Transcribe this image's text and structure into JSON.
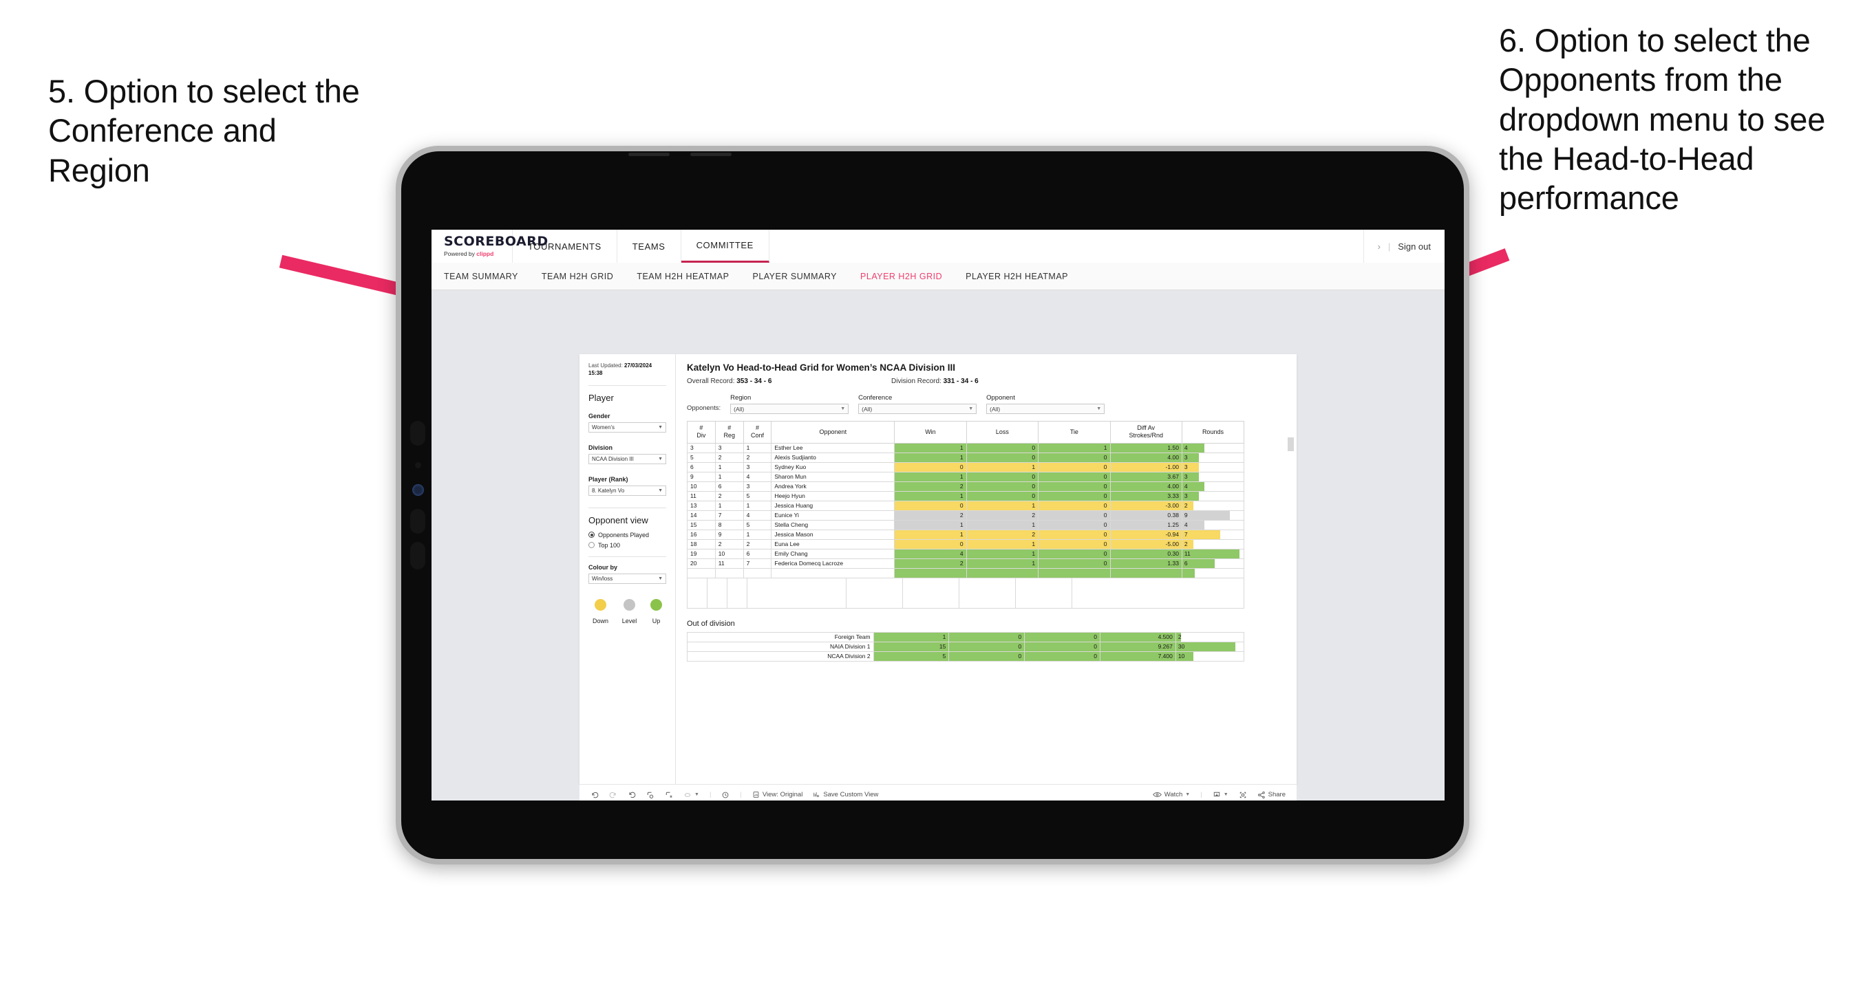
{
  "annotations": {
    "left": "5. Option to select the Conference and Region",
    "right": "6. Option to select the Opponents from the dropdown menu to see the Head-to-Head performance",
    "arrow_color": "#ea2a62"
  },
  "header": {
    "brand_wordmark": "SCOREBOARD",
    "brand_powered_prefix": "Powered by ",
    "brand_accent_name": "clippd",
    "nav": [
      {
        "label": "TOURNAMENTS",
        "active": false
      },
      {
        "label": "TEAMS",
        "active": false
      },
      {
        "label": "COMMITTEE",
        "active": true
      }
    ],
    "chevron": "›",
    "divider": "|",
    "sign_out": "Sign out"
  },
  "sub_nav": [
    {
      "label": "TEAM SUMMARY",
      "active": false
    },
    {
      "label": "TEAM H2H GRID",
      "active": false
    },
    {
      "label": "TEAM H2H HEATMAP",
      "active": false
    },
    {
      "label": "PLAYER SUMMARY",
      "active": false
    },
    {
      "label": "PLAYER H2H GRID",
      "active": true
    },
    {
      "label": "PLAYER H2H HEATMAP",
      "active": false
    }
  ],
  "sidebar": {
    "last_updated_label": "Last Updated: ",
    "last_updated_value": "27/03/2024 15:38",
    "player_heading": "Player",
    "gender_label": "Gender",
    "gender_value": "Women’s",
    "division_label": "Division",
    "division_value": "NCAA Division III",
    "player_rank_label": "Player (Rank)",
    "player_rank_value": "8. Katelyn Vo",
    "opponent_view_heading": "Opponent view",
    "opponent_view_options": [
      {
        "label": "Opponents Played",
        "selected": true
      },
      {
        "label": "Top 100",
        "selected": false
      }
    ],
    "colour_by_label": "Colour by",
    "colour_by_value": "Win/loss",
    "legend": [
      {
        "label": "Down",
        "color": "#f2ce4b"
      },
      {
        "label": "Level",
        "color": "#c4c4c4"
      },
      {
        "label": "Up",
        "color": "#8bc34a"
      }
    ]
  },
  "main": {
    "title": "Katelyn Vo Head-to-Head Grid for Women’s NCAA Division III",
    "overall_record_label": "Overall Record: ",
    "overall_record_value": "353 - 34 - 6",
    "division_record_label": "Division Record: ",
    "division_record_value": "331 - 34 - 6",
    "opponents_label": "Opponents:",
    "filters": [
      {
        "label": "Region",
        "value": "(All)"
      },
      {
        "label": "Conference",
        "value": "(All)"
      },
      {
        "label": "Opponent",
        "value": "(All)"
      }
    ],
    "columns": [
      "# Div",
      "# Reg",
      "# Conf",
      "Opponent",
      "Win",
      "Loss",
      "Tie",
      "Diff Av Strokes/Rnd",
      "Rounds"
    ],
    "columns_split": [
      {
        "l1": "#",
        "l2": "Div"
      },
      {
        "l1": "#",
        "l2": "Reg"
      },
      {
        "l1": "#",
        "l2": "Conf"
      },
      {
        "l1": "Opponent",
        "l2": ""
      },
      {
        "l1": "Win",
        "l2": ""
      },
      {
        "l1": "Loss",
        "l2": ""
      },
      {
        "l1": "Tie",
        "l2": ""
      },
      {
        "l1": "Diff Av",
        "l2": "Strokes/Rnd"
      },
      {
        "l1": "Rounds",
        "l2": ""
      }
    ],
    "rows": [
      {
        "div": "3",
        "reg": "3",
        "conf": "1",
        "opponent": "Esther Lee",
        "win": "1",
        "loss": "0",
        "tie": "1",
        "diff": "1.50",
        "rounds": "4",
        "rounds_pct": 36,
        "state": "win"
      },
      {
        "div": "5",
        "reg": "2",
        "conf": "2",
        "opponent": "Alexis Sudjianto",
        "win": "1",
        "loss": "0",
        "tie": "0",
        "diff": "4.00",
        "rounds": "3",
        "rounds_pct": 27,
        "state": "win"
      },
      {
        "div": "6",
        "reg": "1",
        "conf": "3",
        "opponent": "Sydney Kuo",
        "win": "0",
        "loss": "1",
        "tie": "0",
        "diff": "-1.00",
        "rounds": "3",
        "rounds_pct": 27,
        "state": "loss"
      },
      {
        "div": "9",
        "reg": "1",
        "conf": "4",
        "opponent": "Sharon Mun",
        "win": "1",
        "loss": "0",
        "tie": "0",
        "diff": "3.67",
        "rounds": "3",
        "rounds_pct": 27,
        "state": "win"
      },
      {
        "div": "10",
        "reg": "6",
        "conf": "3",
        "opponent": "Andrea York",
        "win": "2",
        "loss": "0",
        "tie": "0",
        "diff": "4.00",
        "rounds": "4",
        "rounds_pct": 36,
        "state": "win"
      },
      {
        "div": "11",
        "reg": "2",
        "conf": "5",
        "opponent": "Heejo Hyun",
        "win": "1",
        "loss": "0",
        "tie": "0",
        "diff": "3.33",
        "rounds": "3",
        "rounds_pct": 27,
        "state": "win"
      },
      {
        "div": "13",
        "reg": "1",
        "conf": "1",
        "opponent": "Jessica Huang",
        "win": "0",
        "loss": "1",
        "tie": "0",
        "diff": "-3.00",
        "rounds": "2",
        "rounds_pct": 18,
        "state": "loss"
      },
      {
        "div": "14",
        "reg": "7",
        "conf": "4",
        "opponent": "Eunice Yi",
        "win": "2",
        "loss": "2",
        "tie": "0",
        "diff": "0.38",
        "rounds": "9",
        "rounds_pct": 78,
        "state": "level"
      },
      {
        "div": "15",
        "reg": "8",
        "conf": "5",
        "opponent": "Stella Cheng",
        "win": "1",
        "loss": "1",
        "tie": "0",
        "diff": "1.25",
        "rounds": "4",
        "rounds_pct": 36,
        "state": "level"
      },
      {
        "div": "16",
        "reg": "9",
        "conf": "1",
        "opponent": "Jessica Mason",
        "win": "1",
        "loss": "2",
        "tie": "0",
        "diff": "-0.94",
        "rounds": "7",
        "rounds_pct": 62,
        "state": "loss"
      },
      {
        "div": "18",
        "reg": "2",
        "conf": "2",
        "opponent": "Euna Lee",
        "win": "0",
        "loss": "1",
        "tie": "0",
        "diff": "-5.00",
        "rounds": "2",
        "rounds_pct": 18,
        "state": "loss"
      },
      {
        "div": "19",
        "reg": "10",
        "conf": "6",
        "opponent": "Emily Chang",
        "win": "4",
        "loss": "1",
        "tie": "0",
        "diff": "0.30",
        "rounds": "11",
        "rounds_pct": 93,
        "state": "win"
      },
      {
        "div": "20",
        "reg": "11",
        "conf": "7",
        "opponent": "Federica Domecq Lacroze",
        "win": "2",
        "loss": "1",
        "tie": "0",
        "diff": "1.33",
        "rounds": "6",
        "rounds_pct": 53,
        "state": "win"
      }
    ],
    "ood_title": "Out of division",
    "ood_rows": [
      {
        "name": "Foreign Team",
        "win": "1",
        "loss": "0",
        "tie": "0",
        "diff": "4.500",
        "rounds": "2",
        "rounds_pct": 7,
        "state": "win"
      },
      {
        "name": "NAIA Division 1",
        "win": "15",
        "loss": "0",
        "tie": "0",
        "diff": "9.267",
        "rounds": "30",
        "rounds_pct": 88,
        "state": "win"
      },
      {
        "name": "NCAA Division 2",
        "win": "5",
        "loss": "0",
        "tie": "0",
        "diff": "7.400",
        "rounds": "10",
        "rounds_pct": 26,
        "state": "win"
      }
    ]
  },
  "toolbar": {
    "view_label": "View: Original",
    "save_label": "Save Custom View",
    "watch_label": "Watch",
    "share_label": "Share",
    "icons": [
      "undo-icon",
      "redo-icon",
      "revert-icon",
      "refresh-data-icon",
      "pause-icon",
      "highlight-icon",
      "clock-icon",
      "view-icon",
      "save-view-icon",
      "eye-icon",
      "download-icon",
      "fullscreen-icon",
      "share-icon"
    ]
  }
}
